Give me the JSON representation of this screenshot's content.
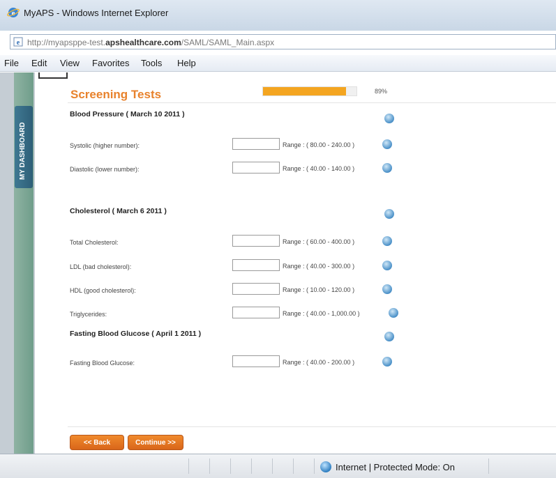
{
  "window": {
    "title": "MyAPS - Windows Internet Explorer",
    "url_prefix": "http://myapsppe-test.",
    "url_domain": "apshealthcare.com",
    "url_path": "/SAML/SAML_Main.aspx"
  },
  "menu": [
    "File",
    "Edit",
    "View",
    "Favorites",
    "Tools",
    "Help"
  ],
  "sidebar": {
    "tab_label": "MY DASHBOARD"
  },
  "page": {
    "title": "Screening Tests",
    "progress_label": "89%",
    "progress_fraction": 0.89
  },
  "sections": [
    {
      "title": "Blood Pressure ( March 10 2011 )",
      "fields": [
        {
          "label": "Systolic (higher number):",
          "value": "",
          "range": "Range : ( 80.00 - 240.00 )"
        },
        {
          "label": "Diastolic (lower number):",
          "value": "",
          "range": "Range : ( 40.00 - 140.00 )"
        }
      ]
    },
    {
      "title": "Cholesterol ( March 6 2011 )",
      "fields": [
        {
          "label": "Total Cholesterol:",
          "value": "",
          "range": "Range : ( 60.00 - 400.00 )"
        },
        {
          "label": "LDL (bad cholesterol):",
          "value": "",
          "range": "Range : ( 40.00 - 300.00 )"
        },
        {
          "label": "HDL (good cholesterol):",
          "value": "",
          "range": "Range : ( 10.00 - 120.00 )"
        },
        {
          "label": "Triglycerides:",
          "value": "",
          "range": "Range : ( 40.00 - 1,000.00 )"
        }
      ]
    },
    {
      "title": "Fasting Blood Glucose ( April 1 2011 )",
      "fields": [
        {
          "label": "Fasting Blood Glucose:",
          "value": "",
          "range": "Range : ( 40.00 - 200.00 )"
        }
      ]
    }
  ],
  "buttons": {
    "back": "<< Back",
    "continue": "Continue >>"
  },
  "status": {
    "zone_text": "Internet | Protected Mode: On"
  },
  "colors": {
    "accent_orange": "#e8822c",
    "progress_fill": "#f4a520",
    "sidebar_tab": "#2e5f78"
  }
}
